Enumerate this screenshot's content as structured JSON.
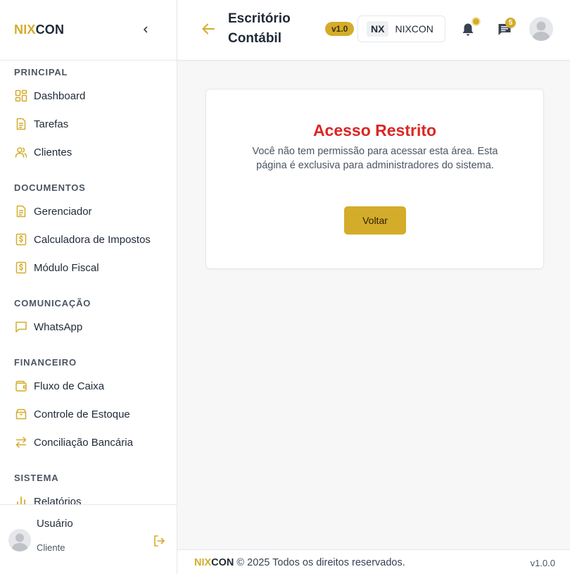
{
  "brand": {
    "part1": "NIX",
    "part2": "CON",
    "accent": "#d4ac2b"
  },
  "sidebar": {
    "sections": [
      {
        "title": "PRINCIPAL",
        "items": [
          {
            "label": "Dashboard",
            "icon": "grid-icon"
          },
          {
            "label": "Tarefas",
            "icon": "document-icon"
          },
          {
            "label": "Clientes",
            "icon": "users-icon"
          }
        ]
      },
      {
        "title": "DOCUMENTOS",
        "items": [
          {
            "label": "Gerenciador",
            "icon": "document-icon"
          },
          {
            "label": "Calculadora de Impostos",
            "icon": "dollar-doc-icon"
          },
          {
            "label": "Módulo Fiscal",
            "icon": "dollar-doc-icon"
          }
        ]
      },
      {
        "title": "COMUNICAÇÃO",
        "items": [
          {
            "label": "WhatsApp",
            "icon": "chat-bubble-icon"
          }
        ]
      },
      {
        "title": "FINANCEIRO",
        "items": [
          {
            "label": "Fluxo de Caixa",
            "icon": "wallet-icon"
          },
          {
            "label": "Controle de Estoque",
            "icon": "box-icon"
          },
          {
            "label": "Conciliação Bancária",
            "icon": "arrows-exchange-icon"
          }
        ]
      },
      {
        "title": "SISTEMA",
        "items": [
          {
            "label": "Relatórios",
            "icon": "bar-chart-icon"
          }
        ]
      }
    ],
    "user": {
      "name": "Usuário",
      "role": "Cliente"
    }
  },
  "header": {
    "title": "Escritório Contábil",
    "version_badge": "v1.0",
    "company_abbr": "NX",
    "company_name": "NIXCON",
    "chat_count": "5"
  },
  "main": {
    "title": "Acesso Restrito",
    "message": "Você não tem permissão para acessar esta área. Esta página é exclusiva para administradores do sistema.",
    "button_label": "Voltar",
    "title_color": "#dc2626"
  },
  "footer": {
    "brand1": "NIX",
    "brand2": "CON",
    "copyright": " © 2025 Todos os direitos reservados.",
    "version": "v1.0.0"
  }
}
